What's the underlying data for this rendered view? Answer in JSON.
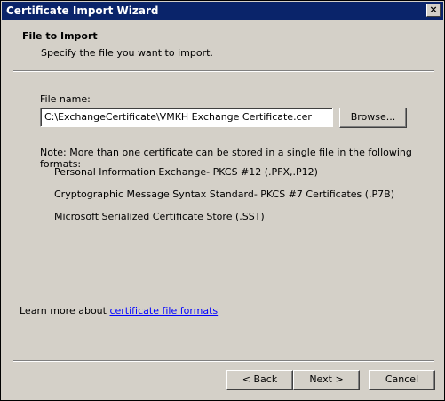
{
  "window": {
    "title": "Certificate Import Wizard",
    "close_glyph": "×"
  },
  "header": {
    "title": "File to Import",
    "subtitle": "Specify the file you want to import."
  },
  "form": {
    "file_name_label": "File name:",
    "file_name_value": "C:\\ExchangeCertificate\\VMKH Exchange Certificate.cer",
    "browse_label": "Browse..."
  },
  "note": {
    "text": "Note:  More than one certificate can be stored in a single file in the following formats:",
    "formats": [
      "Personal Information Exchange- PKCS #12 (.PFX,.P12)",
      "Cryptographic Message Syntax Standard- PKCS #7 Certificates (.P7B)",
      "Microsoft Serialized Certificate Store (.SST)"
    ]
  },
  "learn_more": {
    "prefix": "Learn more about ",
    "link_text": "certificate file formats"
  },
  "buttons": {
    "back": "< Back",
    "next": "Next >",
    "cancel": "Cancel"
  }
}
